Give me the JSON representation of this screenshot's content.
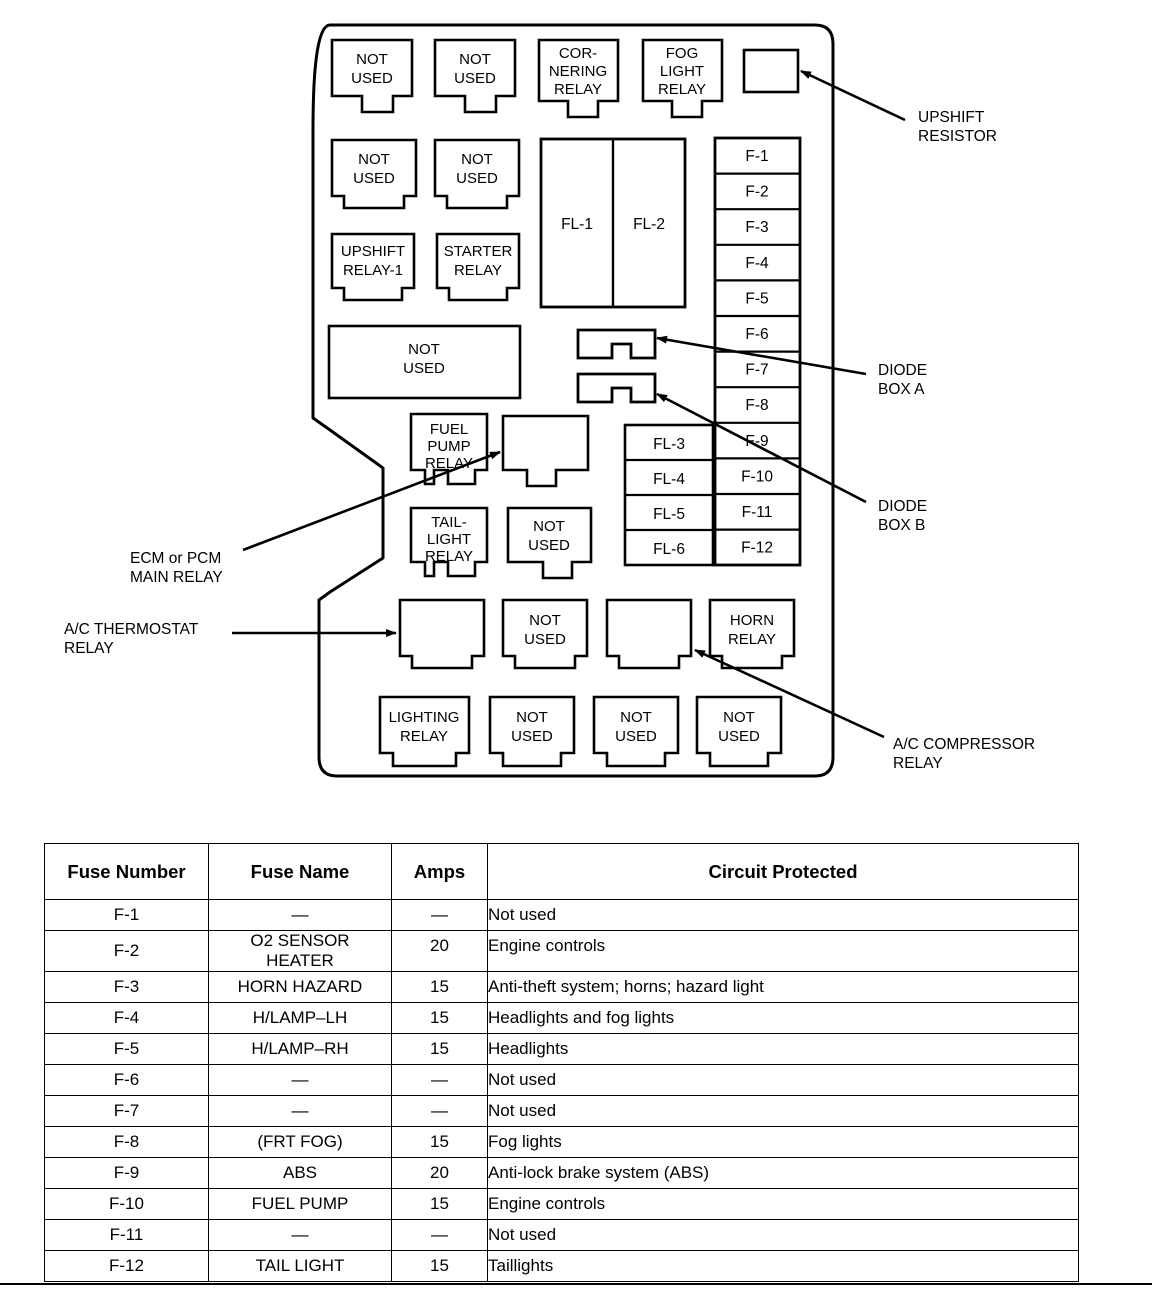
{
  "diagram": {
    "title": "Under-hood fuse and relay box layout",
    "relays_row1": [
      {
        "id": "relay-r1-c1",
        "label": "NOT USED",
        "lines": [
          "NOT",
          "USED"
        ]
      },
      {
        "id": "relay-r1-c2",
        "label": "NOT USED",
        "lines": [
          "NOT",
          "USED"
        ]
      },
      {
        "id": "relay-cornering",
        "label": "CORNERING RELAY",
        "lines": [
          "COR-",
          "NERING",
          "RELAY"
        ]
      },
      {
        "id": "relay-fog-light",
        "label": "FOG LIGHT RELAY",
        "lines": [
          "FOG",
          "LIGHT",
          "RELAY"
        ]
      }
    ],
    "relays_row2": [
      {
        "id": "relay-r2-c1",
        "label": "NOT USED",
        "lines": [
          "NOT",
          "USED"
        ]
      },
      {
        "id": "relay-r2-c2",
        "label": "NOT USED",
        "lines": [
          "NOT",
          "USED"
        ]
      }
    ],
    "relays_row3": [
      {
        "id": "relay-upshift-1",
        "label": "UPSHIFT RELAY-1",
        "lines": [
          "UPSHIFT",
          "RELAY-1"
        ]
      },
      {
        "id": "relay-starter",
        "label": "STARTER RELAY",
        "lines": [
          "STARTER",
          "RELAY"
        ]
      }
    ],
    "big_not_used": {
      "id": "relay-big-not-used",
      "lines": [
        "NOT",
        "USED"
      ]
    },
    "relays_row4": [
      {
        "id": "relay-fuel-pump",
        "label": "FUEL PUMP RELAY",
        "lines": [
          "FUEL",
          "PUMP",
          "RELAY"
        ]
      },
      {
        "id": "relay-ecm-pcm-main",
        "label": "ECM or PCM MAIN RELAY",
        "lines": []
      }
    ],
    "relays_row5": [
      {
        "id": "relay-taillight",
        "label": "TAIL-LIGHT RELAY",
        "lines": [
          "TAIL-",
          "LIGHT",
          "RELAY"
        ]
      },
      {
        "id": "relay-r5-c2",
        "label": "NOT USED",
        "lines": [
          "NOT",
          "USED"
        ]
      }
    ],
    "relays_row6": [
      {
        "id": "relay-ac-thermostat",
        "label": "A/C THERMOSTAT RELAY",
        "lines": []
      },
      {
        "id": "relay-r6-c2",
        "label": "NOT USED",
        "lines": [
          "NOT",
          "USED"
        ]
      },
      {
        "id": "relay-ac-compressor",
        "label": "A/C COMPRESSOR RELAY",
        "lines": []
      },
      {
        "id": "relay-horn",
        "label": "HORN RELAY",
        "lines": [
          "HORN",
          "RELAY"
        ]
      }
    ],
    "relays_row7": [
      {
        "id": "relay-lighting",
        "label": "LIGHTING RELAY",
        "lines": [
          "LIGHTING",
          "RELAY"
        ]
      },
      {
        "id": "relay-r7-c2",
        "label": "NOT USED",
        "lines": [
          "NOT",
          "USED"
        ]
      },
      {
        "id": "relay-r7-c3",
        "label": "NOT USED",
        "lines": [
          "NOT",
          "USED"
        ]
      },
      {
        "id": "relay-r7-c4",
        "label": "NOT USED",
        "lines": [
          "NOT",
          "USED"
        ]
      }
    ],
    "fusible_links_large": [
      "FL-1",
      "FL-2"
    ],
    "fusible_links_small": [
      "FL-3",
      "FL-4",
      "FL-5",
      "FL-6"
    ],
    "fuse_column": [
      "F-1",
      "F-2",
      "F-3",
      "F-4",
      "F-5",
      "F-6",
      "F-7",
      "F-8",
      "F-9",
      "F-10",
      "F-11",
      "F-12"
    ],
    "diode_boxes": [
      {
        "id": "diode-box-a",
        "label": "DIODE BOX A"
      },
      {
        "id": "diode-box-b",
        "label": "DIODE BOX B"
      }
    ],
    "callouts": [
      {
        "id": "callout-upshift-resistor",
        "lines": [
          "UPSHIFT",
          "RESISTOR"
        ],
        "side": "right"
      },
      {
        "id": "callout-diode-box-a",
        "lines": [
          "DIODE",
          "BOX A"
        ],
        "side": "right"
      },
      {
        "id": "callout-diode-box-b",
        "lines": [
          "DIODE",
          "BOX B"
        ],
        "side": "right"
      },
      {
        "id": "callout-ac-compressor-relay",
        "lines": [
          "A/C COMPRESSOR",
          "RELAY"
        ],
        "side": "right"
      },
      {
        "id": "callout-ecm-pcm-main-relay",
        "lines": [
          "ECM or PCM",
          "MAIN RELAY"
        ],
        "side": "left"
      },
      {
        "id": "callout-ac-thermostat-relay",
        "lines": [
          "A/C THERMOSTAT",
          "RELAY"
        ],
        "side": "left"
      }
    ],
    "upshift_resistor": {
      "id": "upshift-resistor",
      "label": ""
    }
  },
  "table": {
    "headers": [
      "Fuse Number",
      "Fuse Name",
      "Amps",
      "Circuit Protected"
    ],
    "rows": [
      {
        "number": "F-1",
        "name": [
          "—"
        ],
        "amps": "—",
        "circuit": "Not used"
      },
      {
        "number": "F-2",
        "name": [
          "O2 SENSOR",
          "HEATER"
        ],
        "amps": "20",
        "circuit": "Engine controls"
      },
      {
        "number": "F-3",
        "name": [
          "HORN HAZARD"
        ],
        "amps": "15",
        "circuit": "Anti-theft system; horns; hazard light"
      },
      {
        "number": "F-4",
        "name": [
          "H/LAMP–LH"
        ],
        "amps": "15",
        "circuit": "Headlights and fog lights"
      },
      {
        "number": "F-5",
        "name": [
          "H/LAMP–RH"
        ],
        "amps": "15",
        "circuit": "Headlights"
      },
      {
        "number": "F-6",
        "name": [
          "—"
        ],
        "amps": "—",
        "circuit": "Not used"
      },
      {
        "number": "F-7",
        "name": [
          "—"
        ],
        "amps": "—",
        "circuit": "Not used"
      },
      {
        "number": "F-8",
        "name": [
          "(FRT FOG)"
        ],
        "amps": "15",
        "circuit": "Fog lights"
      },
      {
        "number": "F-9",
        "name": [
          "ABS"
        ],
        "amps": "20",
        "circuit": "Anti-lock brake system (ABS)"
      },
      {
        "number": "F-10",
        "name": [
          "FUEL PUMP"
        ],
        "amps": "15",
        "circuit": "Engine controls"
      },
      {
        "number": "F-11",
        "name": [
          "—"
        ],
        "amps": "—",
        "circuit": "Not used"
      },
      {
        "number": "F-12",
        "name": [
          "TAIL LIGHT"
        ],
        "amps": "15",
        "circuit": "Taillights"
      }
    ]
  },
  "colors": {
    "ink": "#000000",
    "paper": "#ffffff"
  }
}
